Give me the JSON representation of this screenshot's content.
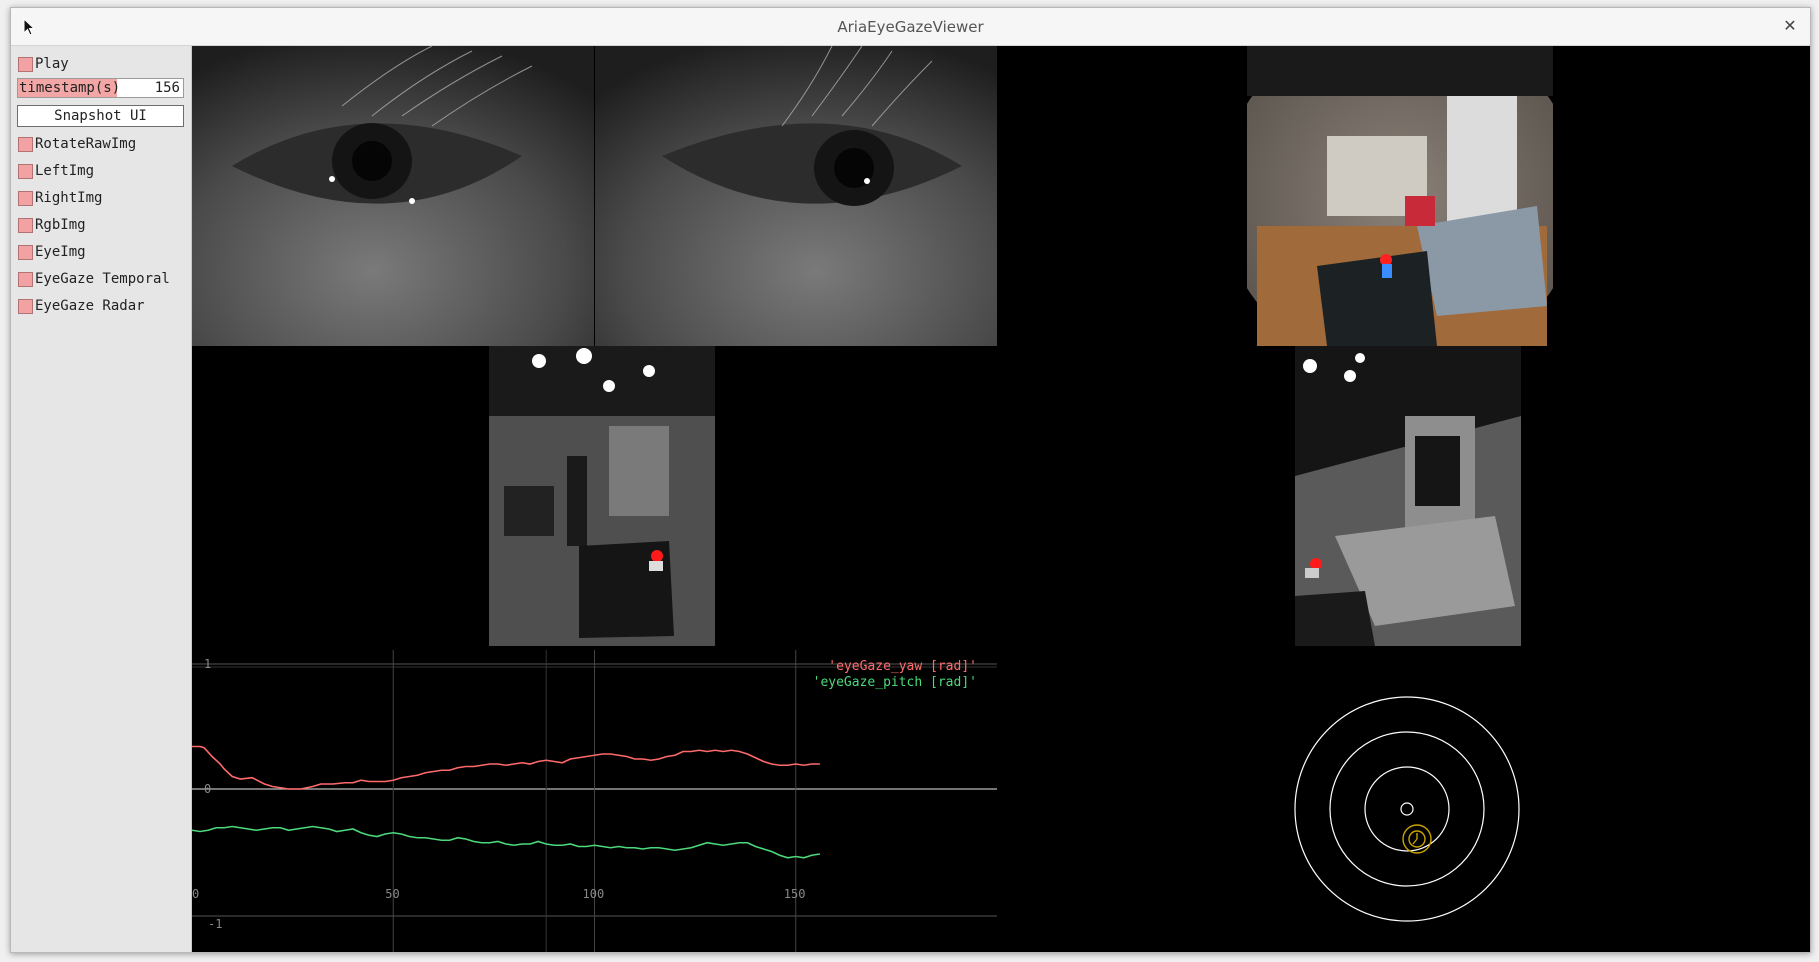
{
  "window": {
    "title": "AriaEyeGazeViewer"
  },
  "panel": {
    "checkboxes": [
      {
        "label": "Play"
      },
      {
        "label": "RotateRawImg"
      },
      {
        "label": "LeftImg"
      },
      {
        "label": "RightImg"
      },
      {
        "label": "RgbImg"
      },
      {
        "label": "EyeImg"
      },
      {
        "label": "EyeGaze Temporal"
      },
      {
        "label": "EyeGaze Radar"
      }
    ],
    "slider": {
      "label": "timestamp(s)",
      "value": "156",
      "fill_fraction": 0.6
    },
    "snapshot_label": "Snapshot UI"
  },
  "plot": {
    "legend": [
      "'eyeGaze_yaw [rad]'",
      "'eyeGaze_pitch [rad]'"
    ],
    "y_ticks": [
      "1",
      "0",
      "-1"
    ],
    "x_ticks": [
      "0",
      "50",
      "100",
      "150"
    ]
  },
  "chart_data": {
    "type": "line",
    "xlim": [
      0,
      200
    ],
    "ylim": [
      -1,
      1
    ],
    "series": [
      {
        "name": "'eyeGaze_yaw [rad]'",
        "color": "#ff6a6a",
        "x": [
          0,
          2,
          3,
          5,
          7,
          8,
          10,
          12,
          15,
          18,
          20,
          22,
          24,
          27,
          30,
          32,
          35,
          38,
          40,
          42,
          44,
          46,
          48,
          50,
          52,
          54,
          56,
          58,
          60,
          62,
          64,
          66,
          68,
          70,
          72,
          74,
          76,
          78,
          80,
          82,
          84,
          86,
          88,
          90,
          92,
          94,
          96,
          98,
          100,
          102,
          104,
          106,
          108,
          110,
          112,
          114,
          116,
          118,
          120,
          122,
          124,
          126,
          128,
          130,
          132,
          134,
          136,
          138,
          140,
          142,
          144,
          146,
          148,
          150,
          152,
          154,
          156
        ],
        "y": [
          0.34,
          0.34,
          0.33,
          0.26,
          0.2,
          0.16,
          0.1,
          0.08,
          0.09,
          0.04,
          0.02,
          0.01,
          0.0,
          0.0,
          0.02,
          0.04,
          0.04,
          0.05,
          0.05,
          0.07,
          0.06,
          0.06,
          0.06,
          0.07,
          0.09,
          0.1,
          0.11,
          0.13,
          0.14,
          0.15,
          0.15,
          0.17,
          0.18,
          0.18,
          0.19,
          0.2,
          0.2,
          0.19,
          0.2,
          0.21,
          0.2,
          0.22,
          0.23,
          0.22,
          0.21,
          0.24,
          0.25,
          0.26,
          0.27,
          0.28,
          0.28,
          0.27,
          0.26,
          0.24,
          0.24,
          0.23,
          0.24,
          0.26,
          0.27,
          0.3,
          0.3,
          0.31,
          0.3,
          0.31,
          0.3,
          0.31,
          0.3,
          0.28,
          0.25,
          0.22,
          0.2,
          0.19,
          0.19,
          0.2,
          0.19,
          0.2,
          0.2
        ]
      },
      {
        "name": "'eyeGaze_pitch [rad]'",
        "color": "#4cd97a",
        "x": [
          0,
          2,
          4,
          6,
          8,
          10,
          12,
          14,
          16,
          18,
          20,
          22,
          24,
          26,
          28,
          30,
          32,
          34,
          36,
          38,
          40,
          42,
          44,
          46,
          48,
          50,
          52,
          54,
          56,
          58,
          60,
          62,
          64,
          66,
          68,
          70,
          72,
          74,
          76,
          78,
          80,
          82,
          84,
          86,
          88,
          90,
          92,
          94,
          96,
          98,
          100,
          102,
          104,
          106,
          108,
          110,
          112,
          114,
          116,
          118,
          120,
          122,
          124,
          126,
          128,
          130,
          132,
          134,
          136,
          138,
          140,
          142,
          144,
          146,
          148,
          150,
          152,
          154,
          156
        ],
        "y": [
          -0.33,
          -0.34,
          -0.33,
          -0.31,
          -0.31,
          -0.3,
          -0.31,
          -0.32,
          -0.33,
          -0.32,
          -0.31,
          -0.31,
          -0.33,
          -0.32,
          -0.31,
          -0.3,
          -0.31,
          -0.32,
          -0.34,
          -0.33,
          -0.32,
          -0.35,
          -0.37,
          -0.38,
          -0.36,
          -0.35,
          -0.36,
          -0.38,
          -0.39,
          -0.39,
          -0.4,
          -0.41,
          -0.41,
          -0.39,
          -0.4,
          -0.42,
          -0.43,
          -0.43,
          -0.42,
          -0.44,
          -0.45,
          -0.44,
          -0.44,
          -0.42,
          -0.44,
          -0.45,
          -0.45,
          -0.44,
          -0.46,
          -0.46,
          -0.45,
          -0.46,
          -0.47,
          -0.46,
          -0.47,
          -0.47,
          -0.48,
          -0.47,
          -0.47,
          -0.48,
          -0.49,
          -0.48,
          -0.47,
          -0.45,
          -0.43,
          -0.44,
          -0.45,
          -0.44,
          -0.43,
          -0.43,
          -0.46,
          -0.48,
          -0.5,
          -0.53,
          -0.55,
          -0.54,
          -0.55,
          -0.53,
          -0.52
        ]
      }
    ]
  },
  "radar": {
    "gaze_offset": [
      0.1,
      0.3
    ]
  }
}
